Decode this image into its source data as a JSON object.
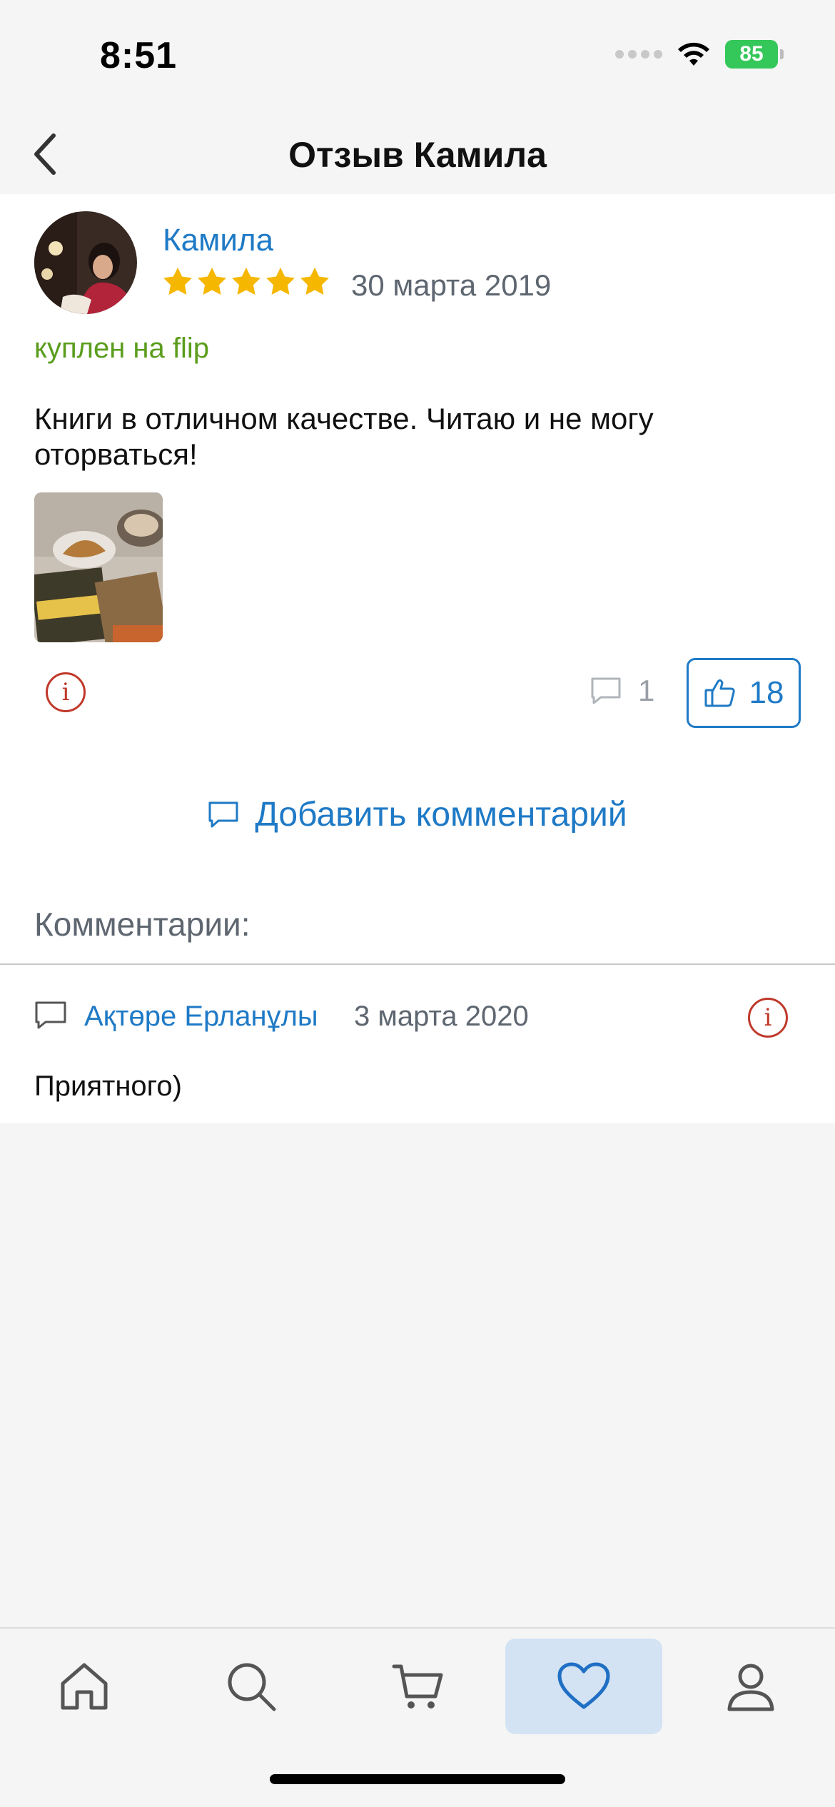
{
  "status_bar": {
    "time": "8:51",
    "battery": "85"
  },
  "nav": {
    "title": "Отзыв Камила"
  },
  "review": {
    "author": "Камила",
    "rating": 5,
    "rating_max": 5,
    "date": "30 марта 2019",
    "bought_label": "куплен на flip",
    "text": "Книги в отличном качестве. Читаю и не могу оторваться!",
    "comments_count": "1",
    "likes_count": "18"
  },
  "actions": {
    "add_comment": "Добавить комментарий"
  },
  "comments": {
    "heading": "Комментарии:",
    "items": [
      {
        "author": "Ақтөре Ерланұлы",
        "date": "3 марта 2020",
        "text": "Приятного)"
      }
    ]
  },
  "report_symbol": "i",
  "colors": {
    "link": "#1f7ac6",
    "star": "#f5b700",
    "bought": "#5a9d1c",
    "report": "#c0392b",
    "active_tab_bg": "#d3e3f3"
  },
  "tab_bar": {
    "items": [
      "home-icon",
      "search-icon",
      "cart-icon",
      "heart-icon",
      "profile-icon"
    ],
    "active": "heart-icon"
  }
}
